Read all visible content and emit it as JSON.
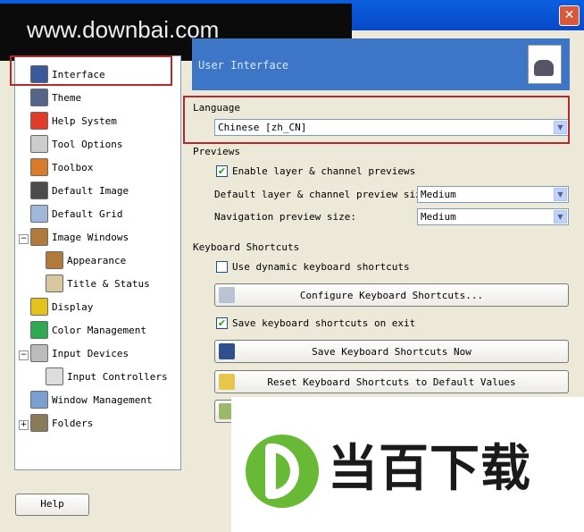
{
  "window": {
    "close_glyph": "✕"
  },
  "watermark_top": "www.downbai.com",
  "tree": [
    {
      "label": "Interface",
      "icon": "interface-icon",
      "color": "#3b5a9a"
    },
    {
      "label": "Theme",
      "icon": "theme-icon",
      "color": "#556688"
    },
    {
      "label": "Help System",
      "icon": "help-system-icon",
      "color": "#e23b2a"
    },
    {
      "label": "Tool Options",
      "icon": "tool-options-icon",
      "color": "#cccccc"
    },
    {
      "label": "Toolbox",
      "icon": "toolbox-icon",
      "color": "#d87b2b"
    },
    {
      "label": "Default Image",
      "icon": "default-image-icon",
      "color": "#4b4b4b"
    },
    {
      "label": "Default Grid",
      "icon": "default-grid-icon",
      "color": "#9fb7d9"
    },
    {
      "label": "Image Windows",
      "icon": "image-windows-icon",
      "color": "#b07a3a"
    },
    {
      "label": "Appearance",
      "icon": "appearance-icon",
      "color": "#b07a3a"
    },
    {
      "label": "Title & Status",
      "icon": "title-status-icon",
      "color": "#d8c6a0"
    },
    {
      "label": "Display",
      "icon": "display-icon",
      "color": "#e4c21b"
    },
    {
      "label": "Color Management",
      "icon": "color-management-icon",
      "color": "#2fa84f"
    },
    {
      "label": "Input Devices",
      "icon": "input-devices-icon",
      "color": "#bbbbbb"
    },
    {
      "label": "Input Controllers",
      "icon": "input-controllers-icon",
      "color": "#dddddd"
    },
    {
      "label": "Window Management",
      "icon": "window-management-icon",
      "color": "#7a9fd0"
    },
    {
      "label": "Folders",
      "icon": "folders-icon",
      "color": "#8a7a5a"
    }
  ],
  "panel": {
    "title": "User Interface",
    "language_heading": "Language",
    "language_value": "Chinese [zh_CN]",
    "previews_heading": "Previews",
    "enable_previews": {
      "label": "Enable layer & channel previews",
      "checked": true
    },
    "preview_size_label": "Default layer & channel preview size:",
    "preview_size_value": "Medium",
    "nav_size_label": "Navigation preview size:",
    "nav_size_value": "Medium",
    "shortcuts_heading": "Keyboard Shortcuts",
    "dynamic_shortcuts": {
      "label": "Use dynamic keyboard shortcuts",
      "checked": false
    },
    "configure_button": "Configure Keyboard Shortcuts...",
    "save_on_exit": {
      "label": "Save keyboard shortcuts on exit",
      "checked": true
    },
    "save_now_button": "Save Keyboard Shortcuts Now",
    "reset_button": "Reset Keyboard Shortcuts to Default Values"
  },
  "help_button": "Help",
  "logo_overlay": {
    "text": "当百下载",
    "color": "#68b936"
  },
  "colors": {
    "header": "#3d75c7",
    "highlight": "#b4282e"
  }
}
